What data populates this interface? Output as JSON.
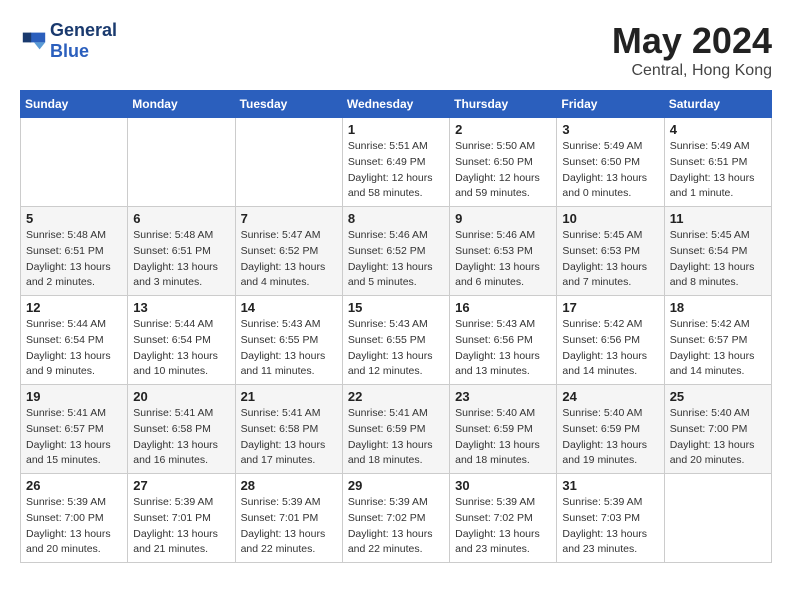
{
  "header": {
    "logo_line1": "General",
    "logo_line2": "Blue",
    "month": "May 2024",
    "location": "Central, Hong Kong"
  },
  "weekdays": [
    "Sunday",
    "Monday",
    "Tuesday",
    "Wednesday",
    "Thursday",
    "Friday",
    "Saturday"
  ],
  "weeks": [
    [
      {
        "day": "",
        "info": ""
      },
      {
        "day": "",
        "info": ""
      },
      {
        "day": "",
        "info": ""
      },
      {
        "day": "1",
        "info": "Sunrise: 5:51 AM\nSunset: 6:49 PM\nDaylight: 12 hours\nand 58 minutes."
      },
      {
        "day": "2",
        "info": "Sunrise: 5:50 AM\nSunset: 6:50 PM\nDaylight: 12 hours\nand 59 minutes."
      },
      {
        "day": "3",
        "info": "Sunrise: 5:49 AM\nSunset: 6:50 PM\nDaylight: 13 hours\nand 0 minutes."
      },
      {
        "day": "4",
        "info": "Sunrise: 5:49 AM\nSunset: 6:51 PM\nDaylight: 13 hours\nand 1 minute."
      }
    ],
    [
      {
        "day": "5",
        "info": "Sunrise: 5:48 AM\nSunset: 6:51 PM\nDaylight: 13 hours\nand 2 minutes."
      },
      {
        "day": "6",
        "info": "Sunrise: 5:48 AM\nSunset: 6:51 PM\nDaylight: 13 hours\nand 3 minutes."
      },
      {
        "day": "7",
        "info": "Sunrise: 5:47 AM\nSunset: 6:52 PM\nDaylight: 13 hours\nand 4 minutes."
      },
      {
        "day": "8",
        "info": "Sunrise: 5:46 AM\nSunset: 6:52 PM\nDaylight: 13 hours\nand 5 minutes."
      },
      {
        "day": "9",
        "info": "Sunrise: 5:46 AM\nSunset: 6:53 PM\nDaylight: 13 hours\nand 6 minutes."
      },
      {
        "day": "10",
        "info": "Sunrise: 5:45 AM\nSunset: 6:53 PM\nDaylight: 13 hours\nand 7 minutes."
      },
      {
        "day": "11",
        "info": "Sunrise: 5:45 AM\nSunset: 6:54 PM\nDaylight: 13 hours\nand 8 minutes."
      }
    ],
    [
      {
        "day": "12",
        "info": "Sunrise: 5:44 AM\nSunset: 6:54 PM\nDaylight: 13 hours\nand 9 minutes."
      },
      {
        "day": "13",
        "info": "Sunrise: 5:44 AM\nSunset: 6:54 PM\nDaylight: 13 hours\nand 10 minutes."
      },
      {
        "day": "14",
        "info": "Sunrise: 5:43 AM\nSunset: 6:55 PM\nDaylight: 13 hours\nand 11 minutes."
      },
      {
        "day": "15",
        "info": "Sunrise: 5:43 AM\nSunset: 6:55 PM\nDaylight: 13 hours\nand 12 minutes."
      },
      {
        "day": "16",
        "info": "Sunrise: 5:43 AM\nSunset: 6:56 PM\nDaylight: 13 hours\nand 13 minutes."
      },
      {
        "day": "17",
        "info": "Sunrise: 5:42 AM\nSunset: 6:56 PM\nDaylight: 13 hours\nand 14 minutes."
      },
      {
        "day": "18",
        "info": "Sunrise: 5:42 AM\nSunset: 6:57 PM\nDaylight: 13 hours\nand 14 minutes."
      }
    ],
    [
      {
        "day": "19",
        "info": "Sunrise: 5:41 AM\nSunset: 6:57 PM\nDaylight: 13 hours\nand 15 minutes."
      },
      {
        "day": "20",
        "info": "Sunrise: 5:41 AM\nSunset: 6:58 PM\nDaylight: 13 hours\nand 16 minutes."
      },
      {
        "day": "21",
        "info": "Sunrise: 5:41 AM\nSunset: 6:58 PM\nDaylight: 13 hours\nand 17 minutes."
      },
      {
        "day": "22",
        "info": "Sunrise: 5:41 AM\nSunset: 6:59 PM\nDaylight: 13 hours\nand 18 minutes."
      },
      {
        "day": "23",
        "info": "Sunrise: 5:40 AM\nSunset: 6:59 PM\nDaylight: 13 hours\nand 18 minutes."
      },
      {
        "day": "24",
        "info": "Sunrise: 5:40 AM\nSunset: 6:59 PM\nDaylight: 13 hours\nand 19 minutes."
      },
      {
        "day": "25",
        "info": "Sunrise: 5:40 AM\nSunset: 7:00 PM\nDaylight: 13 hours\nand 20 minutes."
      }
    ],
    [
      {
        "day": "26",
        "info": "Sunrise: 5:39 AM\nSunset: 7:00 PM\nDaylight: 13 hours\nand 20 minutes."
      },
      {
        "day": "27",
        "info": "Sunrise: 5:39 AM\nSunset: 7:01 PM\nDaylight: 13 hours\nand 21 minutes."
      },
      {
        "day": "28",
        "info": "Sunrise: 5:39 AM\nSunset: 7:01 PM\nDaylight: 13 hours\nand 22 minutes."
      },
      {
        "day": "29",
        "info": "Sunrise: 5:39 AM\nSunset: 7:02 PM\nDaylight: 13 hours\nand 22 minutes."
      },
      {
        "day": "30",
        "info": "Sunrise: 5:39 AM\nSunset: 7:02 PM\nDaylight: 13 hours\nand 23 minutes."
      },
      {
        "day": "31",
        "info": "Sunrise: 5:39 AM\nSunset: 7:03 PM\nDaylight: 13 hours\nand 23 minutes."
      },
      {
        "day": "",
        "info": ""
      }
    ]
  ]
}
